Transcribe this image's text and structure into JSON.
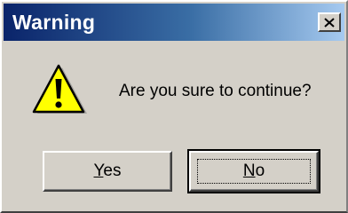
{
  "window": {
    "title": "Warning"
  },
  "dialog": {
    "icon": "warning-icon",
    "message": "Are you sure to continue?"
  },
  "buttons": {
    "yes": {
      "accel": "Y",
      "rest": "es"
    },
    "no": {
      "accel": "N",
      "rest": "o"
    }
  },
  "colors": {
    "titlebar_start": "#0a246a",
    "titlebar_end": "#a6caf0",
    "dialog_face": "#d4d0c8",
    "warning_fill": "#ffff00"
  }
}
